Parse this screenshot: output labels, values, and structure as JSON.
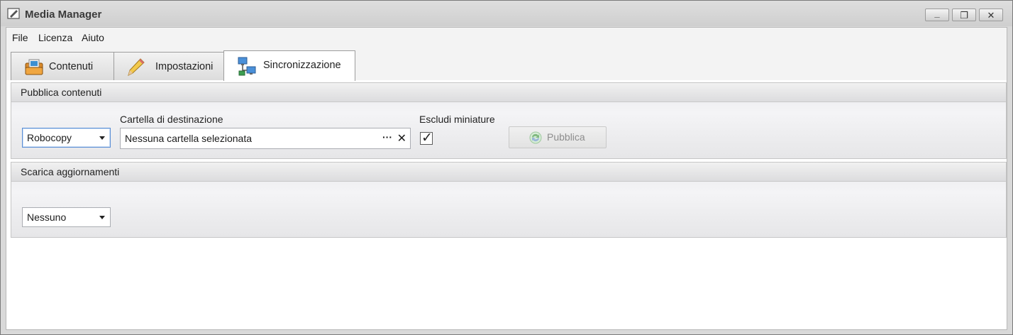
{
  "window": {
    "title": "Media Manager",
    "icons": [
      "pencil-note-icon",
      "minimize-icon",
      "restore-icon",
      "close-icon"
    ],
    "minimize_glyph": "_",
    "restore_glyph": "❐",
    "close_glyph": "✕"
  },
  "menu": {
    "items": [
      "File",
      "Licenza",
      "Aiuto"
    ]
  },
  "tabs": [
    {
      "label": "Contenuti",
      "icon": "folder-icon",
      "active": false
    },
    {
      "label": "Impostazioni",
      "icon": "pencil-icon",
      "active": false
    },
    {
      "label": "Sincronizzazione",
      "icon": "network-computers-icon",
      "active": true
    }
  ],
  "publish": {
    "title": "Pubblica contenuti",
    "method_value": "Robocopy",
    "destination_label": "Cartella di destinazione",
    "destination_value": "Nessuna cartella selezionata",
    "browse_glyph": "···",
    "clear_glyph": "✕",
    "exclude_label": "Escludi miniature",
    "exclude_checked": true,
    "publish_button": "Pubblica",
    "publish_icon": "sync-icon"
  },
  "updates": {
    "title": "Scarica aggiornamenti",
    "source_value": "Nessuno"
  },
  "colors": {
    "title_bar": "#d6d6d6",
    "focus_border": "#5b8fd6",
    "disabled_text": "#8d8d8d"
  }
}
